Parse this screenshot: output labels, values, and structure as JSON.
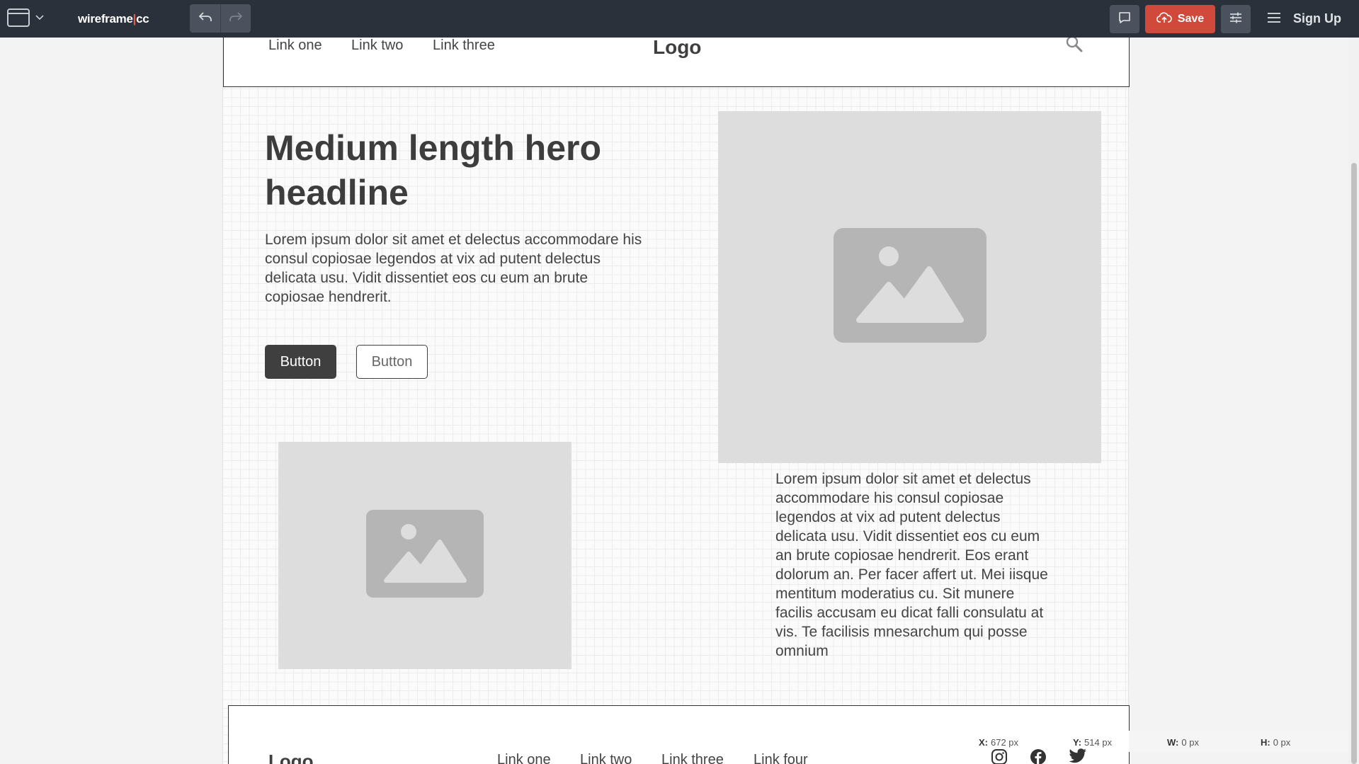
{
  "toolbar": {
    "brand_left": "wireframe",
    "brand_sep": "|",
    "brand_right": "cc",
    "save_label": "Save",
    "signup_label": "Sign Up"
  },
  "header": {
    "links": [
      "Link one",
      "Link two",
      "Link three"
    ],
    "logo": "Logo"
  },
  "hero": {
    "title": "Medium length hero headline",
    "text": "Lorem ipsum dolor sit amet et delectus accommodare his consul copiosae legendos at vix ad putent delectus delicata usu. Vidit dissentiet eos cu eum an brute copiosae hendrerit.",
    "primary_button": "Button",
    "secondary_button": "Button"
  },
  "side_text": "Lorem ipsum dolor sit amet et delectus accommodare his consul copiosae legendos at vix ad putent delectus delicata usu. Vidit dissentiet eos cu eum an brute copiosae hendrerit. Eos erant dolorum an. Per facer affert ut. Mei iisque mentitum moderatius cu. Sit munere facilis accusam eu dicat falli consulatu at vis. Te facilisis mnesarchum qui posse omnium",
  "footer": {
    "logo": "Logo",
    "links": [
      "Link one",
      "Link two",
      "Link three",
      "Link four"
    ]
  },
  "status": {
    "x_label": "X:",
    "x_value": "672 px",
    "y_label": "Y:",
    "y_value": "514 px",
    "w_label": "W:",
    "w_value": "0 px",
    "h_label": "H:",
    "h_value": "0 px"
  },
  "colors": {
    "toolbar_bg": "#2b313b",
    "save_accent": "#d0493a",
    "brand_separator": "#e35b4a"
  },
  "icons": {
    "window": "window-layout-icon",
    "undo": "undo-arrow-icon",
    "redo": "redo-arrow-icon",
    "comment": "comment-icon",
    "save": "cloud-upload-icon",
    "settings": "sliders-icon",
    "menu": "hamburger-menu-icon",
    "search": "search-icon",
    "image": "image-placeholder-icon",
    "instagram": "instagram-icon",
    "facebook": "facebook-icon",
    "twitter": "twitter-icon"
  }
}
